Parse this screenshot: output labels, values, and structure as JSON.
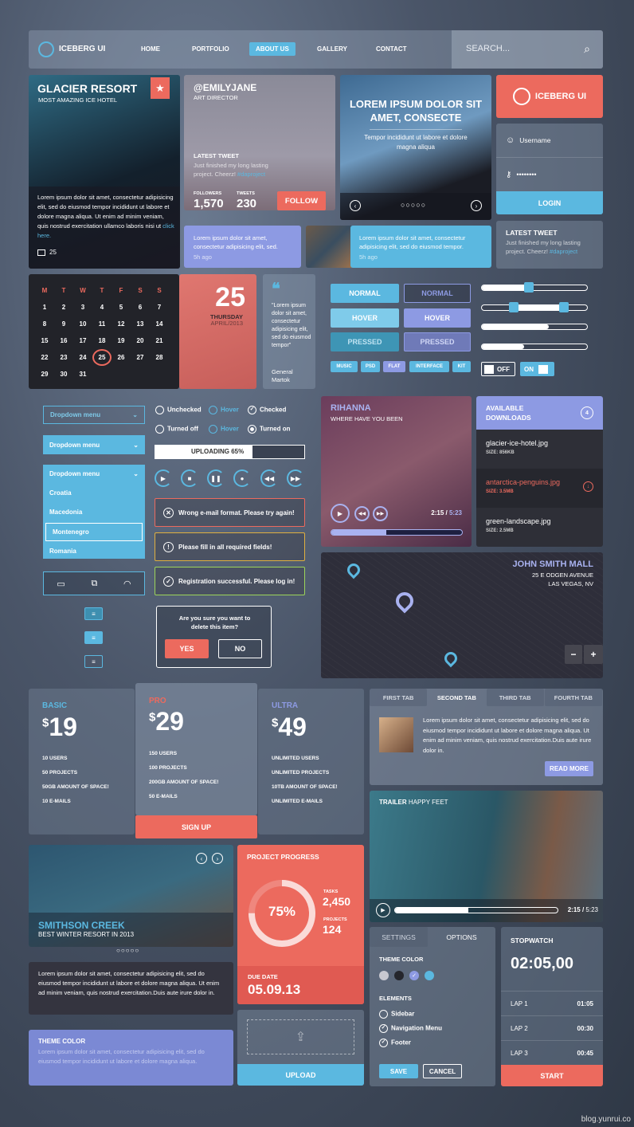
{
  "colors": {
    "red": "#ec6a5e",
    "blue": "#5bb8e0",
    "purple": "#8d9ae3",
    "dark": "#2a2b33"
  },
  "nav": {
    "brand": "ICEBERG UI",
    "items": [
      "HOME",
      "PORTFOLIO",
      "ABOUT US",
      "GALLERY",
      "CONTACT"
    ],
    "active": "ABOUT US",
    "search_placeholder": "SEARCH...",
    "search_icon": "search-icon"
  },
  "glacier": {
    "title": "GLACIER RESORT",
    "subtitle": "MOST AMAZING ICE HOTEL",
    "text": "Lorem ipsum dolor sit amet, consectetur adipisicing elit, sed do eiusmod tempor incididunt ut labore et dolore magna aliqua. Ut enim ad minim veniam, quis nostrud exercitation ullamco laboris nisi ut",
    "link": "click here.",
    "comments": "25"
  },
  "profile": {
    "handle": "@EMILYJANE",
    "role": "ART DIRECTOR",
    "tweet_label": "LATEST TWEET",
    "tweet": "Just finished my long lasting project. Cheerz!",
    "hashtag": "#daproject",
    "followers_label": "FOLLOWERS",
    "followers": "1,570",
    "tweets_label": "TWEETS",
    "tweets": "230",
    "follow": "FOLLOW"
  },
  "bubble1": {
    "text": "Lorem ipsum dolor sit amet, consectetur adipisicing elit, sed.",
    "time": "5h ago"
  },
  "bubble2": {
    "text": "Lorem ipsum dolor sit amet, consectetur adipisicing elit, sed do eiusmod tempor.",
    "time": "5h ago"
  },
  "hero": {
    "title": "LOREM IPSUM DOLOR SIT AMET, CONSECTE",
    "subtitle": "Tempor incididunt ut labore et dolore magna aliqua"
  },
  "login": {
    "brand": "ICEBERG UI",
    "username_placeholder": "Username",
    "password": "••••••••",
    "button": "LOGIN"
  },
  "tweet2": {
    "label": "LATEST TWEET",
    "text": "Just finished my long lasting project. Cheerz!",
    "hashtag": "#daproject"
  },
  "calendar": {
    "days": [
      "M",
      "T",
      "W",
      "T",
      "F",
      "S",
      "S"
    ],
    "weeks": [
      [
        "1",
        "2",
        "3",
        "4",
        "5",
        "6",
        "7"
      ],
      [
        "8",
        "9",
        "10",
        "11",
        "12",
        "13",
        "14"
      ],
      [
        "15",
        "16",
        "17",
        "18",
        "19",
        "20",
        "21"
      ],
      [
        "22",
        "23",
        "24",
        "25",
        "26",
        "27",
        "28"
      ],
      [
        "29",
        "30",
        "31",
        "",
        "",
        "",
        ""
      ]
    ],
    "selected": "25",
    "big_day": "25",
    "weekday": "THURSDAY",
    "month": "APRIL/2013"
  },
  "quote": {
    "text": "\"Lorem ipsum dolor sit amet, consectetur adipisicing elit, sed do eiusmod tempor\"",
    "author": "General Martok"
  },
  "buttons": {
    "normal": "NORMAL",
    "hover": "HOVER",
    "pressed": "PRESSED"
  },
  "tags": [
    "MUSIC",
    "PSD",
    "FLAT",
    "INTERFACE",
    "KIT"
  ],
  "sliders": {
    "single": 45,
    "range": [
      30,
      78
    ],
    "progress1": 64,
    "progress2": 40
  },
  "toggles": {
    "off": "OFF",
    "on": "ON"
  },
  "dropdowns": {
    "label": "Dropdown menu",
    "options": [
      "Croatia",
      "Macedonia",
      "Montenegro",
      "Romania"
    ],
    "selected": "Montenegro"
  },
  "checks": {
    "unchecked": "Unchecked",
    "hover": "Hover",
    "checked": "Checked",
    "off": "Turned off",
    "on": "Turned on"
  },
  "upload_bar": {
    "label": "UPLOADING 65%",
    "percent": 65
  },
  "alerts": {
    "error": "Wrong e-mail format. Please try again!",
    "warning": "Please fill in all required fields!",
    "success": "Registration successful. Please log in!"
  },
  "dialog": {
    "text": "Are you sure you want to delete this item?",
    "yes": "YES",
    "no": "NO"
  },
  "music": {
    "artist": "RIHANNA",
    "song": "WHERE HAVE YOU BEEN",
    "current": "2:15",
    "total": "5:23",
    "progress": 42
  },
  "downloads": {
    "title": "AVAILABLE DOWNLOADS",
    "count": "4",
    "items": [
      {
        "name": "glacier-ice-hotel.jpg",
        "size": "SIZE: 856KB"
      },
      {
        "name": "antarctica-penguins.jpg",
        "size": "SIZE: 3.5MB"
      },
      {
        "name": "green-landscape.jpg",
        "size": "SIZE: 2.5MB"
      }
    ]
  },
  "map": {
    "name": "JOHN SMITH MALL",
    "address1": "25 E ODGEN AVENUE",
    "address2": "LAS VEGAS, NV",
    "zoom_out": "−",
    "zoom_in": "+"
  },
  "pricing": [
    {
      "name": "BASIC",
      "price": "19",
      "features": [
        "10 USERS",
        "50 PROJECTS",
        "50GB AMOUNT OF SPACE!",
        "10 E-MAILS"
      ]
    },
    {
      "name": "PRO",
      "price": "29",
      "features": [
        "150 USERS",
        "100 PROJECTS",
        "200GB AMOUNT OF SPACE!",
        "50 E-MAILS"
      ],
      "cta": "SIGN UP"
    },
    {
      "name": "ULTRA",
      "price": "49",
      "features": [
        "UNLIMITED USERS",
        "UNLIMITED PROJECTS",
        "10TB AMOUNT OF SPACE!",
        "UNLIMITED E-MAILS"
      ]
    }
  ],
  "currency": "$",
  "tabs": {
    "items": [
      "FIRST TAB",
      "SECOND TAB",
      "THIRD TAB",
      "FOURTH TAB"
    ],
    "active": "SECOND TAB",
    "text": "Lorem ipsum dolor sit amet, consectetur adipisicing elit, sed do eiusmod tempor incididunt ut labore et dolore magna aliqua. Ut enim ad minim veniam, quis nostrud exercitation.Duis aute irure dolor in.",
    "read_more": "READ MORE"
  },
  "video": {
    "label": "TRAILER",
    "title": "HAPPY FEET",
    "current": "2:15",
    "total": "5:23",
    "progress": 45
  },
  "slider2": {
    "title": "SMITHSON CREEK",
    "subtitle": "BEST WINTER RESORT IN 2013"
  },
  "bubble3": {
    "text": "Lorem ipsum dolor sit amet, consectetur adipisicing elit, sed do eiusmod tempor incididunt ut labore et dolore magna aliqua. Ut enim ad minim veniam, quis nostrud exercitation.Duis aute irure dolor in."
  },
  "theme_box": {
    "title": "THEME COLOR",
    "text": "Lorem ipsum dolor sit amet, consectetur adipisicing elit, sed do eiusmod tempor incididunt ut labore et dolore magna aliqua."
  },
  "project": {
    "title": "PROJECT PROGRESS",
    "percent_label": "75%",
    "percent": 75,
    "tasks_label": "TASKS",
    "tasks": "2,450",
    "projects_label": "PROJECTS",
    "projects": "124",
    "due_label": "DUE DATE",
    "due": "05.09.13"
  },
  "upload": {
    "button": "UPLOAD"
  },
  "settings": {
    "tabs": [
      "SETTINGS",
      "OPTIONS"
    ],
    "active": "OPTIONS",
    "theme_label": "THEME COLOR",
    "swatches": [
      "#c8c8d0",
      "#25262c",
      "#8d9ae3",
      "#5bb8e0"
    ],
    "elements_label": "ELEMENTS",
    "elements": [
      {
        "label": "Sidebar",
        "checked": false
      },
      {
        "label": "Navigation Menu",
        "checked": true
      },
      {
        "label": "Footer",
        "checked": true
      }
    ],
    "save": "SAVE",
    "cancel": "CANCEL"
  },
  "stopwatch": {
    "title": "STOPWATCH",
    "time": "02:05,00",
    "laps": [
      {
        "label": "LAP 1",
        "time": "01:05"
      },
      {
        "label": "LAP 2",
        "time": "00:30"
      },
      {
        "label": "LAP 3",
        "time": "00:45"
      }
    ],
    "start": "START"
  },
  "watermark": "blog.yunrui.co"
}
